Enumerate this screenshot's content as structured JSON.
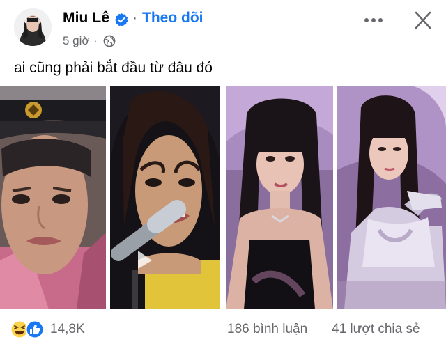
{
  "post": {
    "author": "Miu Lê",
    "follow_label": "Theo dõi",
    "separator": "·",
    "time": "5 giờ",
    "privacy_icon": "globe-icon",
    "caption": "ai cũng phải bắt đầu từ đâu đó",
    "photos": [
      {
        "icon": "photo-1"
      },
      {
        "icon": "photo-2"
      },
      {
        "icon": "photo-3"
      },
      {
        "icon": "photo-4"
      }
    ],
    "reactions": {
      "icons": [
        "haha-reaction-icon",
        "like-reaction-icon"
      ],
      "count": "14,8K"
    },
    "comments": "186 bình luận",
    "shares": "41 lượt chia sẻ"
  },
  "colors": {
    "accent": "#1877f2",
    "muted": "#65676b",
    "text": "#050505"
  }
}
